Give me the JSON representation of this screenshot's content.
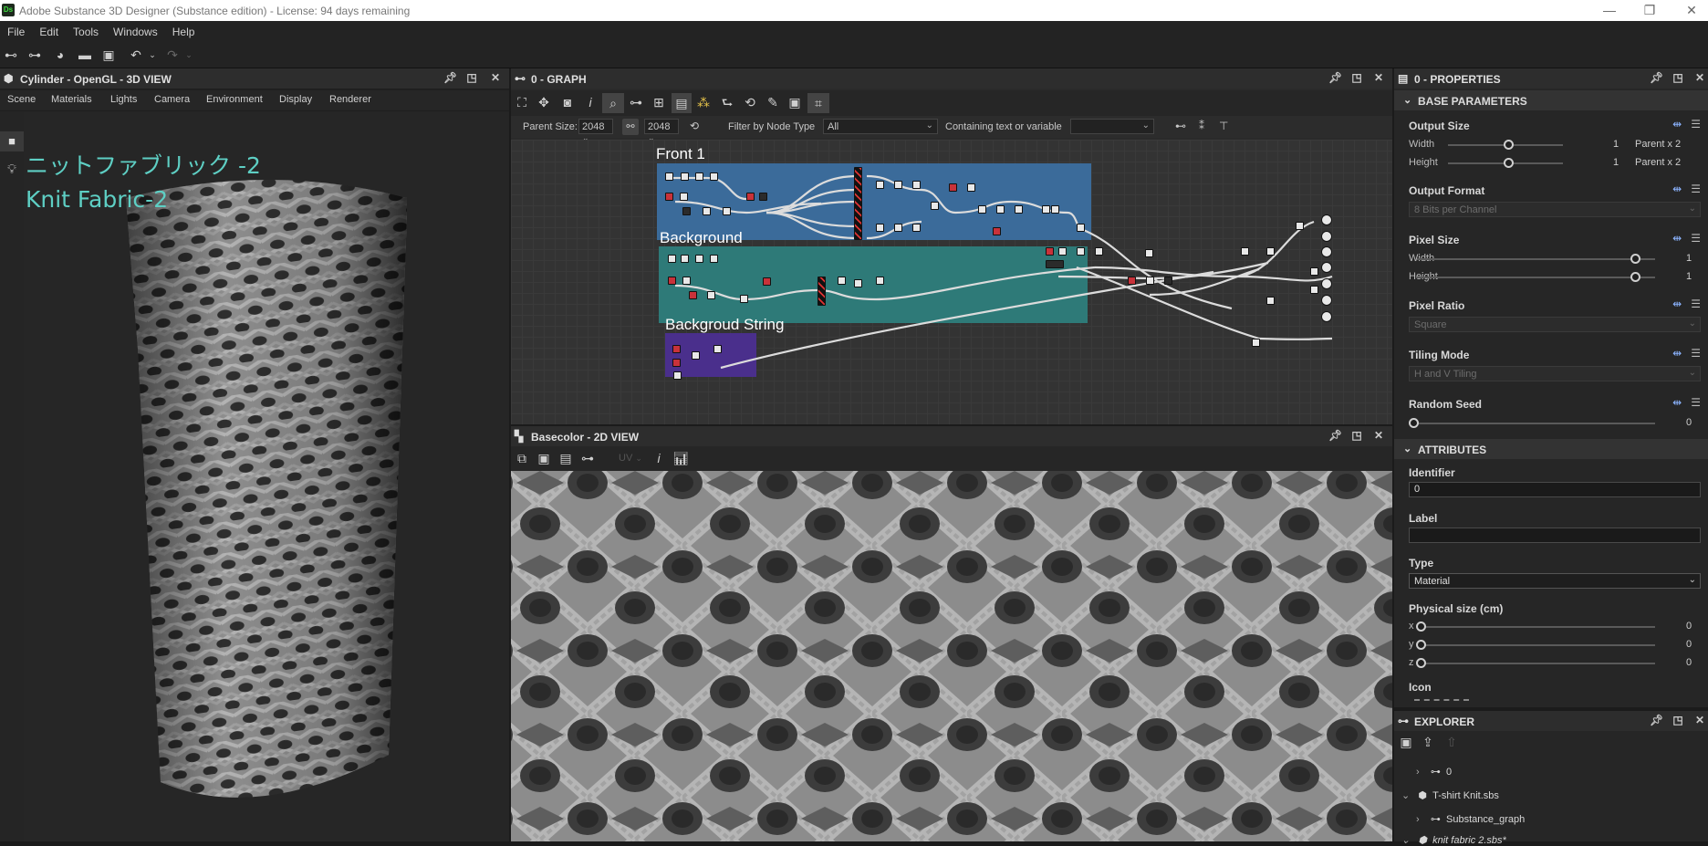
{
  "window": {
    "title": "Adobe Substance 3D Designer (Substance edition) - License: 94 days remaining",
    "logo": "Ds",
    "controls": [
      "—",
      "❐",
      "✕"
    ]
  },
  "menu": [
    "File",
    "Edit",
    "Tools",
    "Windows",
    "Help"
  ],
  "view3d": {
    "title": "Cylinder - OpenGL - 3D VIEW",
    "tabs": [
      "Scene",
      "Materials",
      "Lights",
      "Camera",
      "Environment",
      "Display",
      "Renderer"
    ],
    "overlay_jp": "ニットファブリック -2",
    "overlay_en": "Knit Fabric-2"
  },
  "graph": {
    "title": "0 - GRAPH",
    "parent_size_label": "Parent Size:",
    "parent_size_value": "2048",
    "size_value_2": "2048",
    "filter_label": "Filter by Node Type",
    "filter_value": "All",
    "containing_label": "Containing text or variable",
    "containing_value": "",
    "frames": [
      {
        "label": "Front 1",
        "color": "#3b6b9a"
      },
      {
        "label": "Background",
        "color": "#2e7a78"
      },
      {
        "label": "Backgroud String",
        "color": "#4a2f8c"
      }
    ]
  },
  "view2d": {
    "title": "Basecolor - 2D VIEW",
    "uv_label": "UV"
  },
  "properties": {
    "title": "0 - PROPERTIES",
    "base_section": "BASE PARAMETERS",
    "output_size": {
      "label": "Output Size",
      "width_label": "Width",
      "width_value": "1",
      "width_parent": "Parent x 2",
      "height_label": "Height",
      "height_value": "1",
      "height_parent": "Parent x 2"
    },
    "output_format": {
      "label": "Output Format",
      "value": "8 Bits per Channel"
    },
    "pixel_size": {
      "label": "Pixel Size",
      "width_label": "Width",
      "width_value": "1",
      "height_label": "Height",
      "height_value": "1"
    },
    "pixel_ratio": {
      "label": "Pixel Ratio",
      "value": "Square"
    },
    "tiling_mode": {
      "label": "Tiling Mode",
      "value": "H and V Tiling"
    },
    "random_seed": {
      "label": "Random Seed",
      "value": "0"
    },
    "attributes_section": "ATTRIBUTES",
    "identifier": {
      "label": "Identifier",
      "value": "0"
    },
    "label_field": {
      "label": "Label",
      "value": ""
    },
    "type": {
      "label": "Type",
      "value": "Material"
    },
    "physical_size": {
      "label": "Physical size (cm)",
      "x_label": "x",
      "x_value": "0",
      "y_label": "y",
      "y_value": "0",
      "z_label": "z",
      "z_value": "0"
    },
    "icon_label": "Icon"
  },
  "explorer": {
    "title": "EXPLORER",
    "items": [
      {
        "label": "0"
      },
      {
        "label": "T-shirt Knit.sbs"
      },
      {
        "label": "Substance_graph"
      },
      {
        "label": "knit fabric 2.sbs*"
      }
    ]
  },
  "colors": {
    "accent_teal": "#5ecfc4",
    "frame_front": "#3b6b9a",
    "frame_background": "#2e7a78",
    "frame_string": "#4a2f8c"
  }
}
